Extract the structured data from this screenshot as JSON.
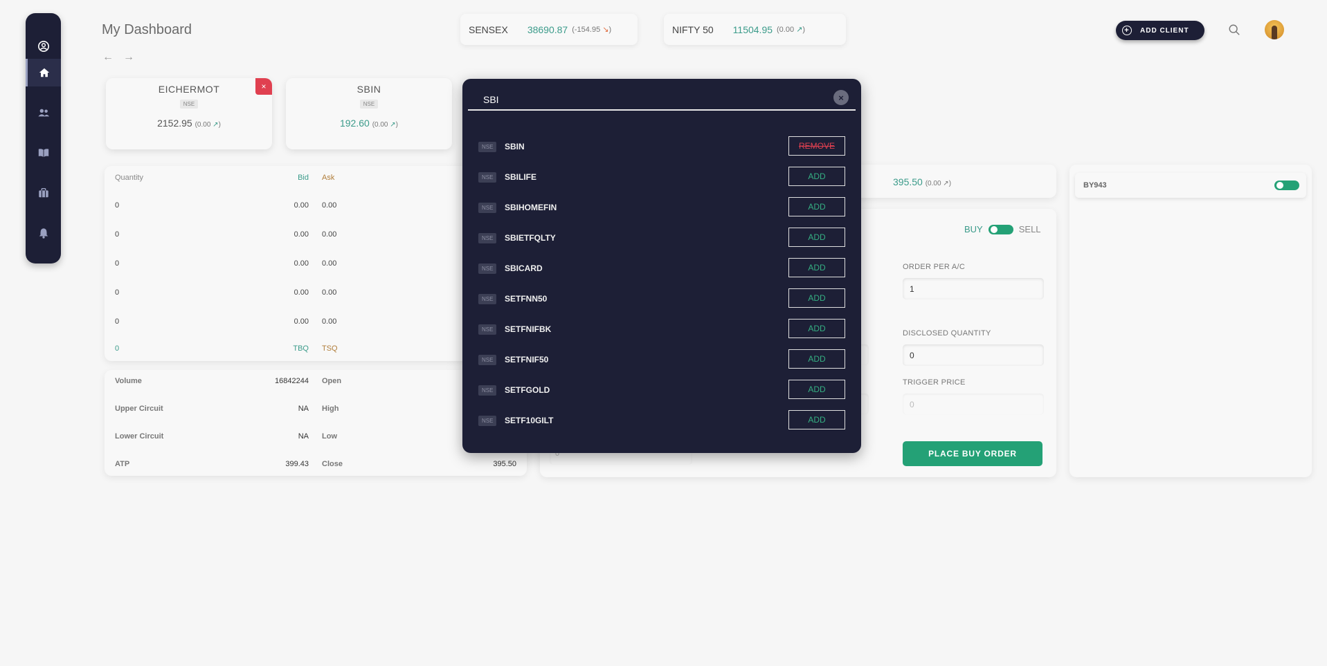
{
  "header": {
    "title": "My Dashboard",
    "back_arrow": "←",
    "forward_arrow": "→",
    "add_client_label": "ADD CLIENT"
  },
  "tickers": [
    {
      "name": "SENSEX",
      "value": "38690.87",
      "change": "(-154.95",
      "direction": "down"
    },
    {
      "name": "NIFTY 50",
      "value": "11504.95",
      "change": "(0.00",
      "direction": "up"
    }
  ],
  "watchlist": [
    {
      "symbol": "EICHERMOT",
      "exchange": "NSE",
      "price": "2152.95",
      "change": "(0.00"
    },
    {
      "symbol": "SBIN",
      "exchange": "NSE",
      "price": "192.60",
      "change": "(0.00"
    }
  ],
  "depth": {
    "headers": {
      "qty": "Quantity",
      "bid": "Bid",
      "ask": "Ask"
    },
    "rows": [
      {
        "qty": "0",
        "bid": "0.00",
        "ask": "0.00"
      },
      {
        "qty": "0",
        "bid": "0.00",
        "ask": "0.00"
      },
      {
        "qty": "0",
        "bid": "0.00",
        "ask": "0.00"
      },
      {
        "qty": "0",
        "bid": "0.00",
        "ask": "0.00"
      },
      {
        "qty": "0",
        "bid": "0.00",
        "ask": "0.00"
      }
    ],
    "footer": {
      "qty": "0",
      "bid": "TBQ",
      "ask": "TSQ"
    }
  },
  "stats": [
    {
      "l1": "Volume",
      "v1": "16842244",
      "l2": "Open",
      "v2": ""
    },
    {
      "l1": "Upper Circuit",
      "v1": "NA",
      "l2": "High",
      "v2": ""
    },
    {
      "l1": "Lower Circuit",
      "v1": "NA",
      "l2": "Low",
      "v2": ""
    },
    {
      "l1": "ATP",
      "v1": "399.43",
      "l2": "Close",
      "v2": "395.50"
    }
  ],
  "quote": {
    "price": "395.50",
    "change": "(0.00"
  },
  "order": {
    "buy_label": "BUY",
    "sell_label": "SELL",
    "order_per_ac_label": "ORDER PER A/C",
    "order_per_ac_value": "1",
    "disclosed_qty_label": "DISCLOSED QUANTITY",
    "disclosed_qty_value": "0",
    "trigger_price_label": "TRIGGER PRICE",
    "trigger_price_placeholder": "0",
    "ghost_value": "0",
    "place_label": "PLACE BUY ORDER"
  },
  "clients": [
    {
      "id": "BY943",
      "enabled": true
    }
  ],
  "search_modal": {
    "query": "SBI",
    "results": [
      {
        "exchange": "NSE",
        "symbol": "SBIN",
        "action": "REMOVE"
      },
      {
        "exchange": "NSE",
        "symbol": "SBILIFE",
        "action": "ADD"
      },
      {
        "exchange": "NSE",
        "symbol": "SBIHOMEFIN",
        "action": "ADD"
      },
      {
        "exchange": "NSE",
        "symbol": "SBIETFQLTY",
        "action": "ADD"
      },
      {
        "exchange": "NSE",
        "symbol": "SBICARD",
        "action": "ADD"
      },
      {
        "exchange": "NSE",
        "symbol": "SETFNN50",
        "action": "ADD"
      },
      {
        "exchange": "NSE",
        "symbol": "SETFNIFBK",
        "action": "ADD"
      },
      {
        "exchange": "NSE",
        "symbol": "SETFNIF50",
        "action": "ADD"
      },
      {
        "exchange": "NSE",
        "symbol": "SETFGOLD",
        "action": "ADD"
      },
      {
        "exchange": "NSE",
        "symbol": "SETF10GILT",
        "action": "ADD"
      }
    ]
  },
  "icons": {
    "up_arrow": "↗",
    "down_arrow": "↘",
    "close": "×",
    "plus": "+"
  },
  "colors": {
    "navy": "#1d1f36",
    "teal": "#3b9b8a",
    "green": "#24a176",
    "red": "#e04050"
  }
}
